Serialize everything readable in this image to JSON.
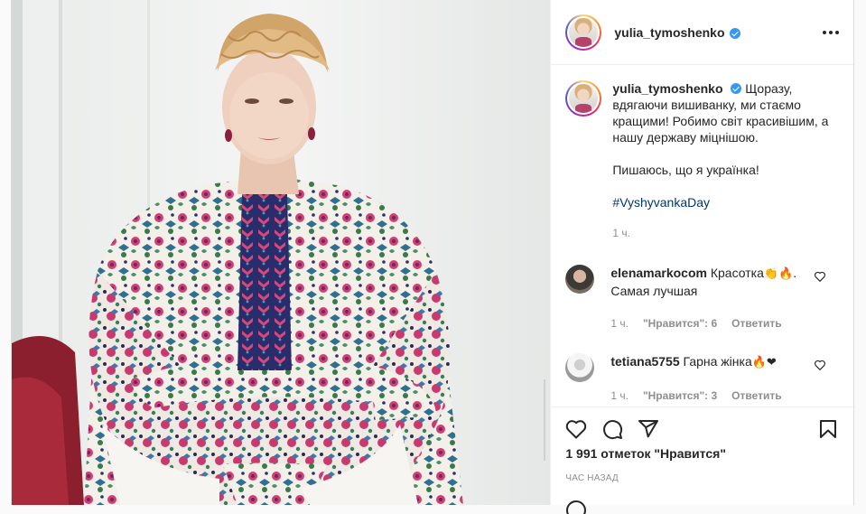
{
  "post": {
    "username": "yulia_tymoshenko",
    "more_label": "More options",
    "caption": {
      "line1": "Щоразу, вдягаючи вишиванку, ми стаємо кращими! Робимо світ красивішим, а нашу державу міцнішою.",
      "line2": "Пишаюсь, що я українка!",
      "hashtag": "#VyshyvankaDay",
      "time": "1 ч."
    },
    "comments": [
      {
        "username": "elenamarkocom",
        "text": "Красотка",
        "emoji": "👏🔥",
        "text_tail": ". Самая лучшая",
        "time": "1 ч.",
        "likes": "\"Нравится\": 6",
        "reply": "Ответить"
      },
      {
        "username": "tetiana5755",
        "text": "Гарна жінка",
        "emoji": "🔥❤",
        "text_tail": "",
        "time": "1 ч.",
        "likes": "\"Нравится\": 3",
        "reply": "Ответить"
      }
    ],
    "likes_count": "1 991 отметок \"Нравится\"",
    "time_ago": "ЧАС НАЗАД"
  },
  "icons": [
    "heart-icon",
    "comment-icon",
    "share-icon",
    "bookmark-icon",
    "verified-badge-icon",
    "more-dots-icon"
  ],
  "colors": {
    "verified": "#3897f0",
    "hashtag": "#00376b",
    "muted": "#8e8e8e",
    "text": "#262626"
  }
}
